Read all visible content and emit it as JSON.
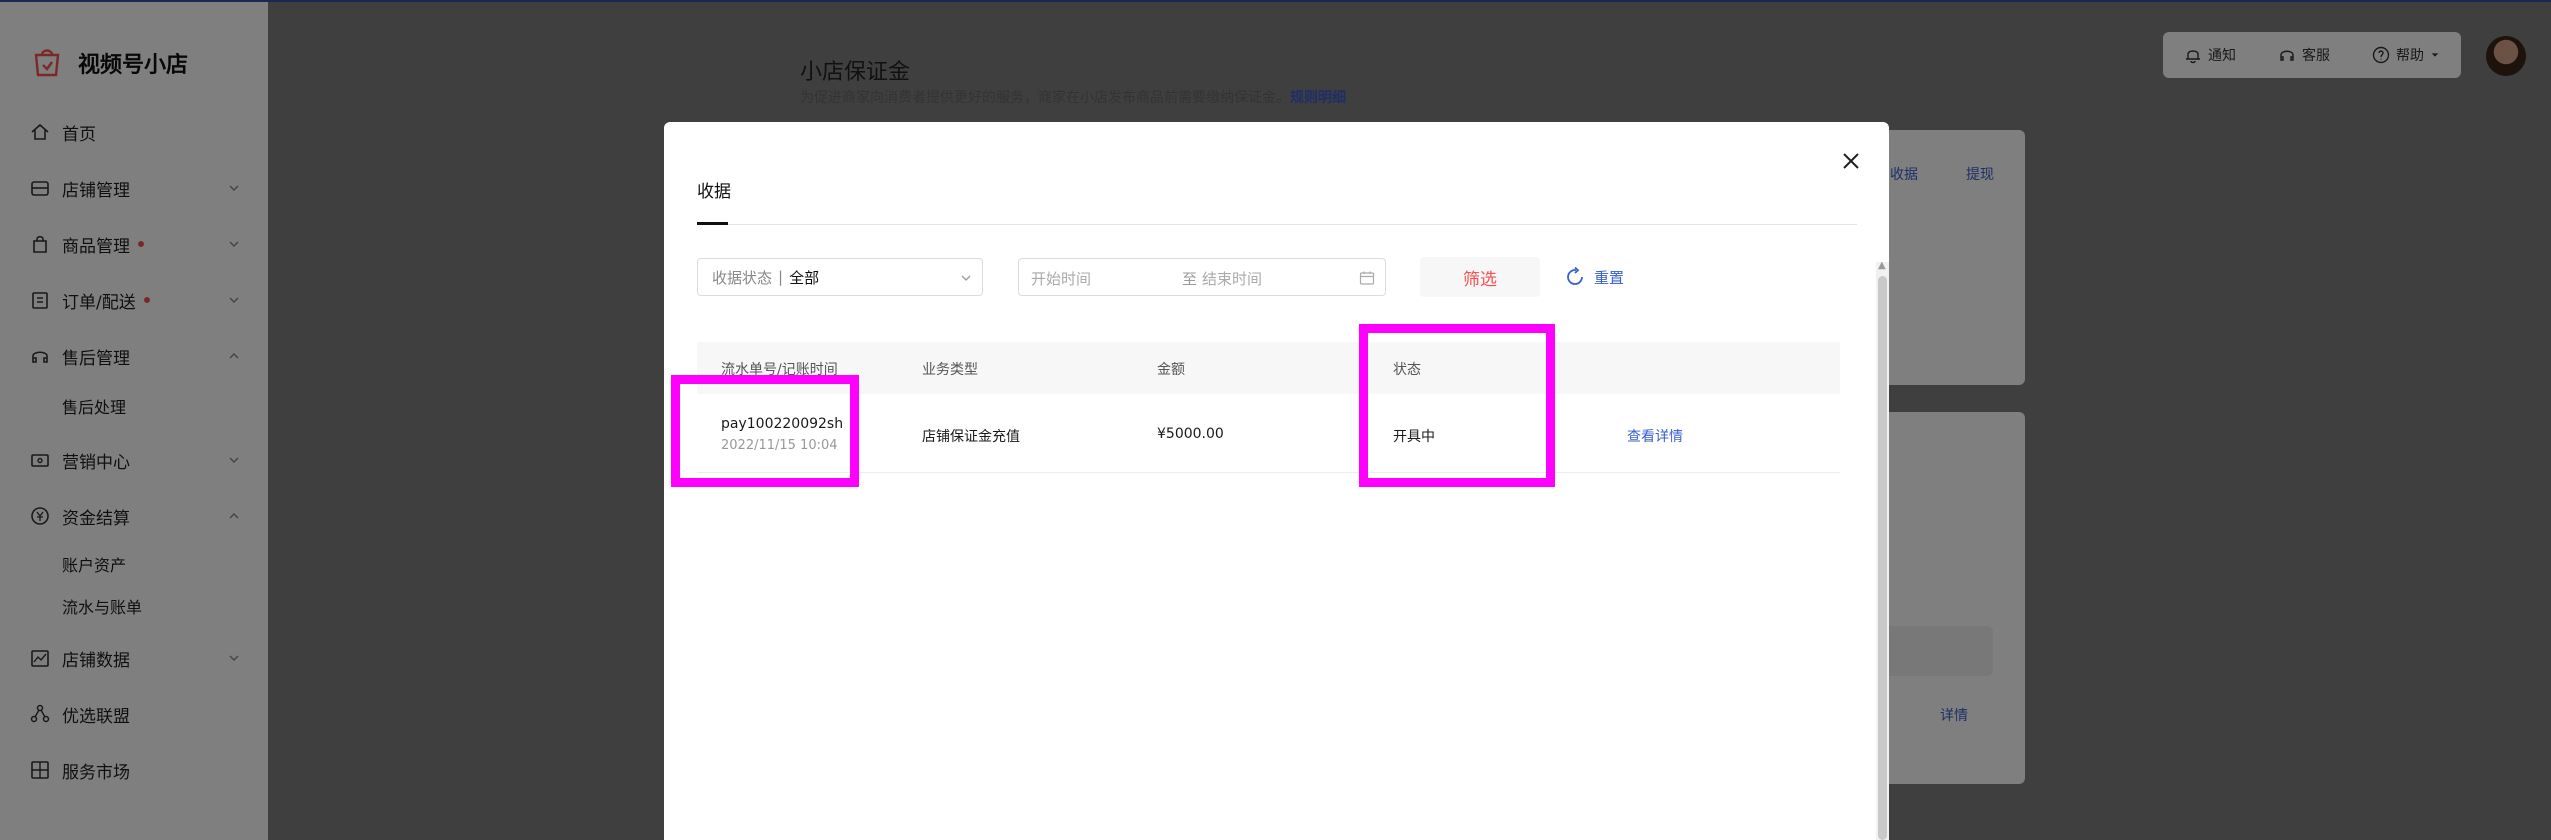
{
  "sidebar": {
    "logo": "视频号小店",
    "items": [
      {
        "label": "首页"
      },
      {
        "label": "店铺管理"
      },
      {
        "label": "商品管理"
      },
      {
        "label": "订单/配送"
      },
      {
        "label": "售后管理"
      },
      {
        "label": "售后处理"
      },
      {
        "label": "营销中心"
      },
      {
        "label": "资金结算"
      },
      {
        "label": "账户资产"
      },
      {
        "label": "流水与账单"
      },
      {
        "label": "店铺数据"
      },
      {
        "label": "优选联盟"
      },
      {
        "label": "服务市场"
      }
    ]
  },
  "page": {
    "title": "小店保证金",
    "desc": "为促进商家向消费者提供更好的服务，商家在小店发布商品前需要缴纳保证金。",
    "desc_link": "规则明细",
    "links": {
      "collect": "收据",
      "withdraw": "提现",
      "detail": "详情"
    }
  },
  "topbar": {
    "notify": "通知",
    "service": "客服",
    "help": "帮助"
  },
  "modal": {
    "tab": "收据",
    "filter": {
      "status_label": "收据状态",
      "status_sep": "|",
      "status_value": "全部",
      "start_placeholder": "开始时间",
      "to": "至",
      "end_placeholder": "结束时间",
      "filter_btn": "筛选",
      "reset_btn": "重置"
    },
    "table": {
      "headers": [
        "流水单号/记账时间",
        "业务类型",
        "金额",
        "状态"
      ],
      "rows": [
        {
          "id": "pay100220092sh",
          "time": "2022/11/15 10:04",
          "type": "店铺保证金充值",
          "amount": "¥5000.00",
          "status": "开具中",
          "action": "查看详情"
        }
      ]
    }
  },
  "colors": {
    "accent": "#fa5151",
    "link": "#3a5fcd",
    "highlight": "#ff00ff"
  }
}
